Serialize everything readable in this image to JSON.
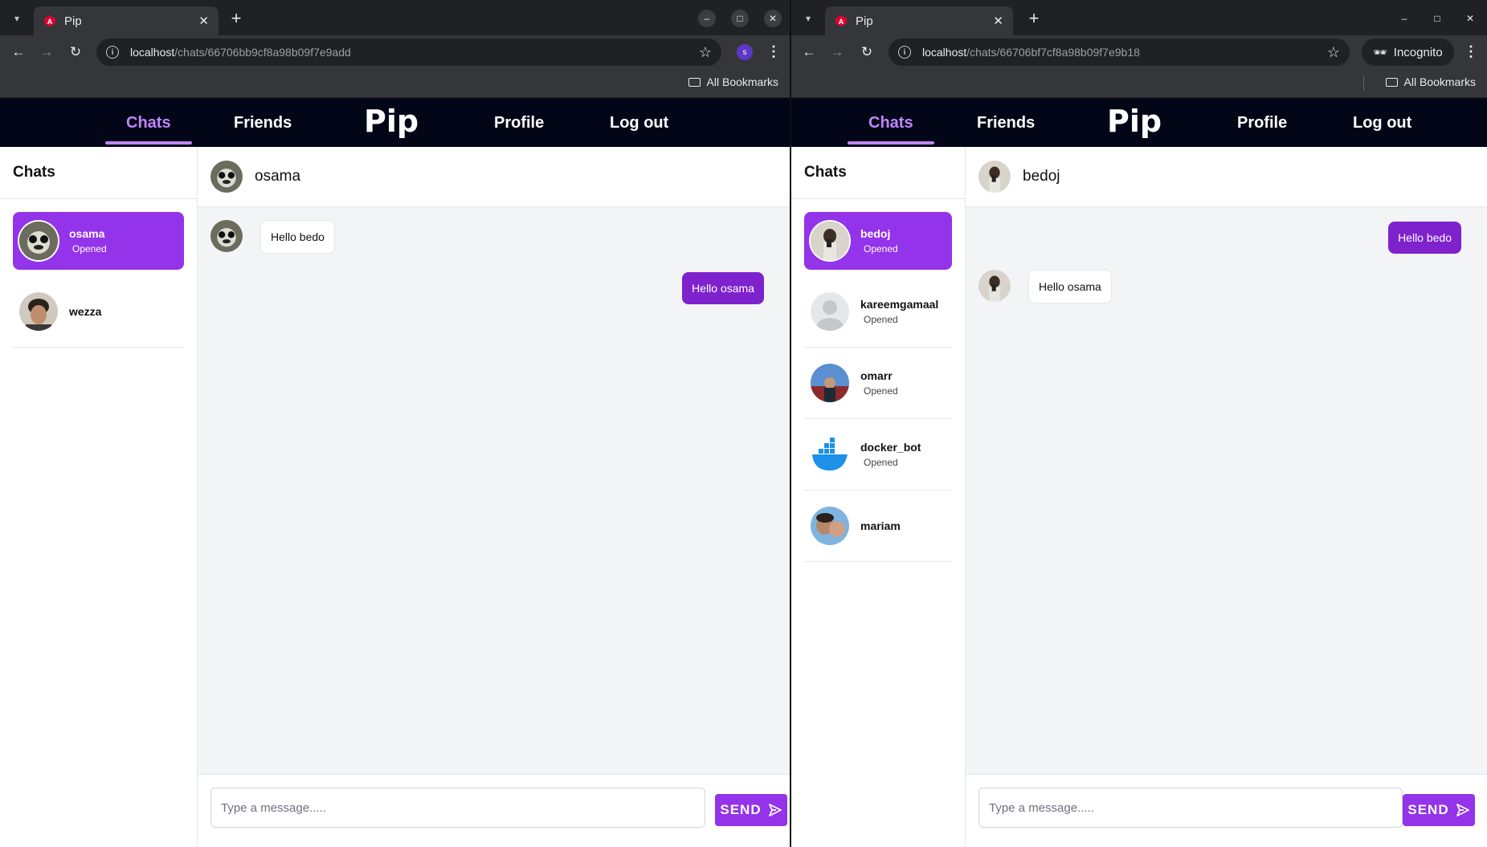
{
  "left_window": {
    "tab": {
      "title": "Pip"
    },
    "url": {
      "host": "localhost",
      "path": "/chats/66706bb9cf8a98b09f7e9add"
    },
    "profile_initial": "s",
    "bookmarks_label": "All Bookmarks",
    "nav": {
      "chats": "Chats",
      "friends": "Friends",
      "profile": "Profile",
      "logout": "Log out",
      "logo": "Pip"
    },
    "sidebar": {
      "title": "Chats",
      "items": [
        {
          "name": "osama",
          "status": "Opened",
          "active": true
        },
        {
          "name": "wezza",
          "status": "",
          "active": false
        }
      ]
    },
    "conversation": {
      "contact": "osama",
      "messages": [
        {
          "text": "Hello bedo",
          "direction": "incoming"
        },
        {
          "text": "Hello osama",
          "direction": "outgoing"
        }
      ]
    },
    "composer": {
      "placeholder": "Type a message.....",
      "send_label": "SEND"
    }
  },
  "right_window": {
    "tab": {
      "title": "Pip"
    },
    "url": {
      "host": "localhost",
      "path": "/chats/66706bf7cf8a98b09f7e9b18"
    },
    "incognito_label": "Incognito",
    "bookmarks_label": "All Bookmarks",
    "nav": {
      "chats": "Chats",
      "friends": "Friends",
      "profile": "Profile",
      "logout": "Log out",
      "logo": "Pip"
    },
    "sidebar": {
      "title": "Chats",
      "items": [
        {
          "name": "bedoj",
          "status": "Opened",
          "active": true
        },
        {
          "name": "kareemgamaal",
          "status": "Opened",
          "active": false
        },
        {
          "name": "omarr",
          "status": "Opened",
          "active": false
        },
        {
          "name": "docker_bot",
          "status": "Opened",
          "active": false
        },
        {
          "name": "mariam",
          "status": "",
          "active": false
        }
      ]
    },
    "conversation": {
      "contact": "bedoj",
      "messages": [
        {
          "text": "Hello bedo",
          "direction": "outgoing"
        },
        {
          "text": "Hello osama",
          "direction": "incoming"
        }
      ]
    },
    "composer": {
      "placeholder": "Type a message.....",
      "send_label": "SEND"
    }
  },
  "colors": {
    "accent": "#9333ea",
    "accent_light": "#c084fc",
    "nav_bg": "#020617",
    "chrome_bg": "#202124",
    "chrome_toolbar": "#35363a"
  }
}
